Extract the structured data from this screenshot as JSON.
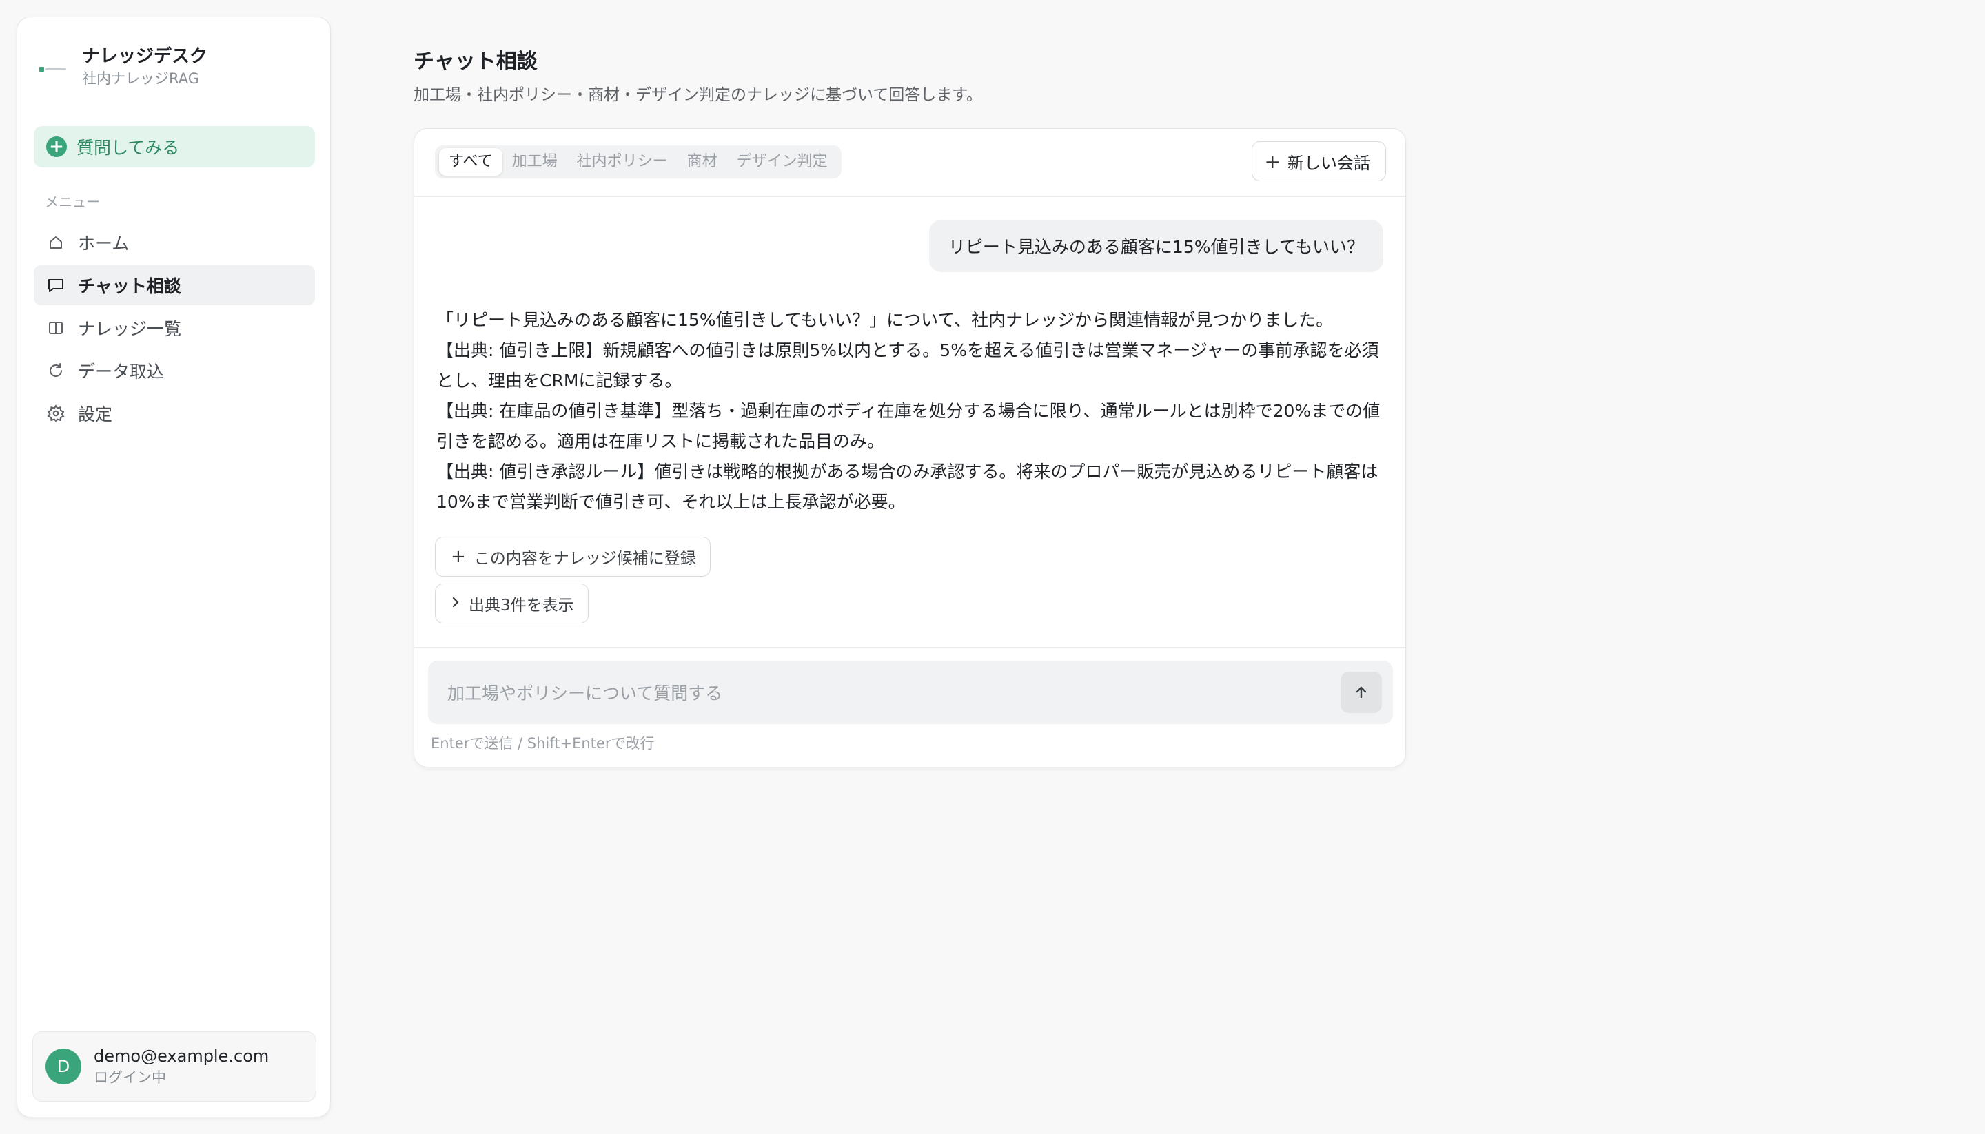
{
  "sidebar": {
    "brand_title": "ナレッジデスク",
    "brand_subtitle": "社内ナレッジRAG",
    "ask_button": "質問してみる",
    "menu_heading": "メニュー",
    "items": [
      {
        "label": "ホーム",
        "icon": "home-icon",
        "active": false
      },
      {
        "label": "チャット相談",
        "icon": "chat-icon",
        "active": true
      },
      {
        "label": "ナレッジ一覧",
        "icon": "book-icon",
        "active": false
      },
      {
        "label": "データ取込",
        "icon": "refresh-icon",
        "active": false
      },
      {
        "label": "設定",
        "icon": "gear-icon",
        "active": false
      }
    ],
    "user": {
      "initial": "D",
      "email": "demo@example.com",
      "status": "ログイン中"
    }
  },
  "header": {
    "title": "チャット相談",
    "description": "加工場・社内ポリシー・商材・デザイン判定のナレッジに基づいて回答します。"
  },
  "chat": {
    "filters": [
      "すべて",
      "加工場",
      "社内ポリシー",
      "商材",
      "デザイン判定"
    ],
    "active_filter": "すべて",
    "new_chat_label": "新しい会話",
    "user_message": "リピート見込みのある顧客に15%値引きしてもいい？",
    "answer_lines": [
      "「リピート見込みのある顧客に15%値引きしてもいい？」について、社内ナレッジから関連情報が見つかりました。",
      "【出典: 値引き上限】新規顧客への値引きは原則5%以内とする。5%を超える値引きは営業マネージャーの事前承認を必須とし、理由をCRMに記録する。",
      "【出典: 在庫品の値引き基準】型落ち・過剰在庫のボディ在庫を処分する場合に限り、通常ルールとは別枠で20%までの値引きを認める。適用は在庫リストに掲載された品目のみ。",
      "【出典: 値引き承認ルール】値引きは戦略的根拠がある場合のみ承認する。将来のプロパー販売が見込めるリピート顧客は10%まで営業判断で値引き可、それ以上は上長承認が必要。"
    ],
    "register_button": "この内容をナレッジ候補に登録",
    "sources_button": "出典3件を表示",
    "input_placeholder": "加工場やポリシーについて質問する",
    "hint": "Enterで送信 / Shift+Enterで改行"
  },
  "colors": {
    "accent": "#3aa57a",
    "accent_bg": "#e3f4ed"
  }
}
